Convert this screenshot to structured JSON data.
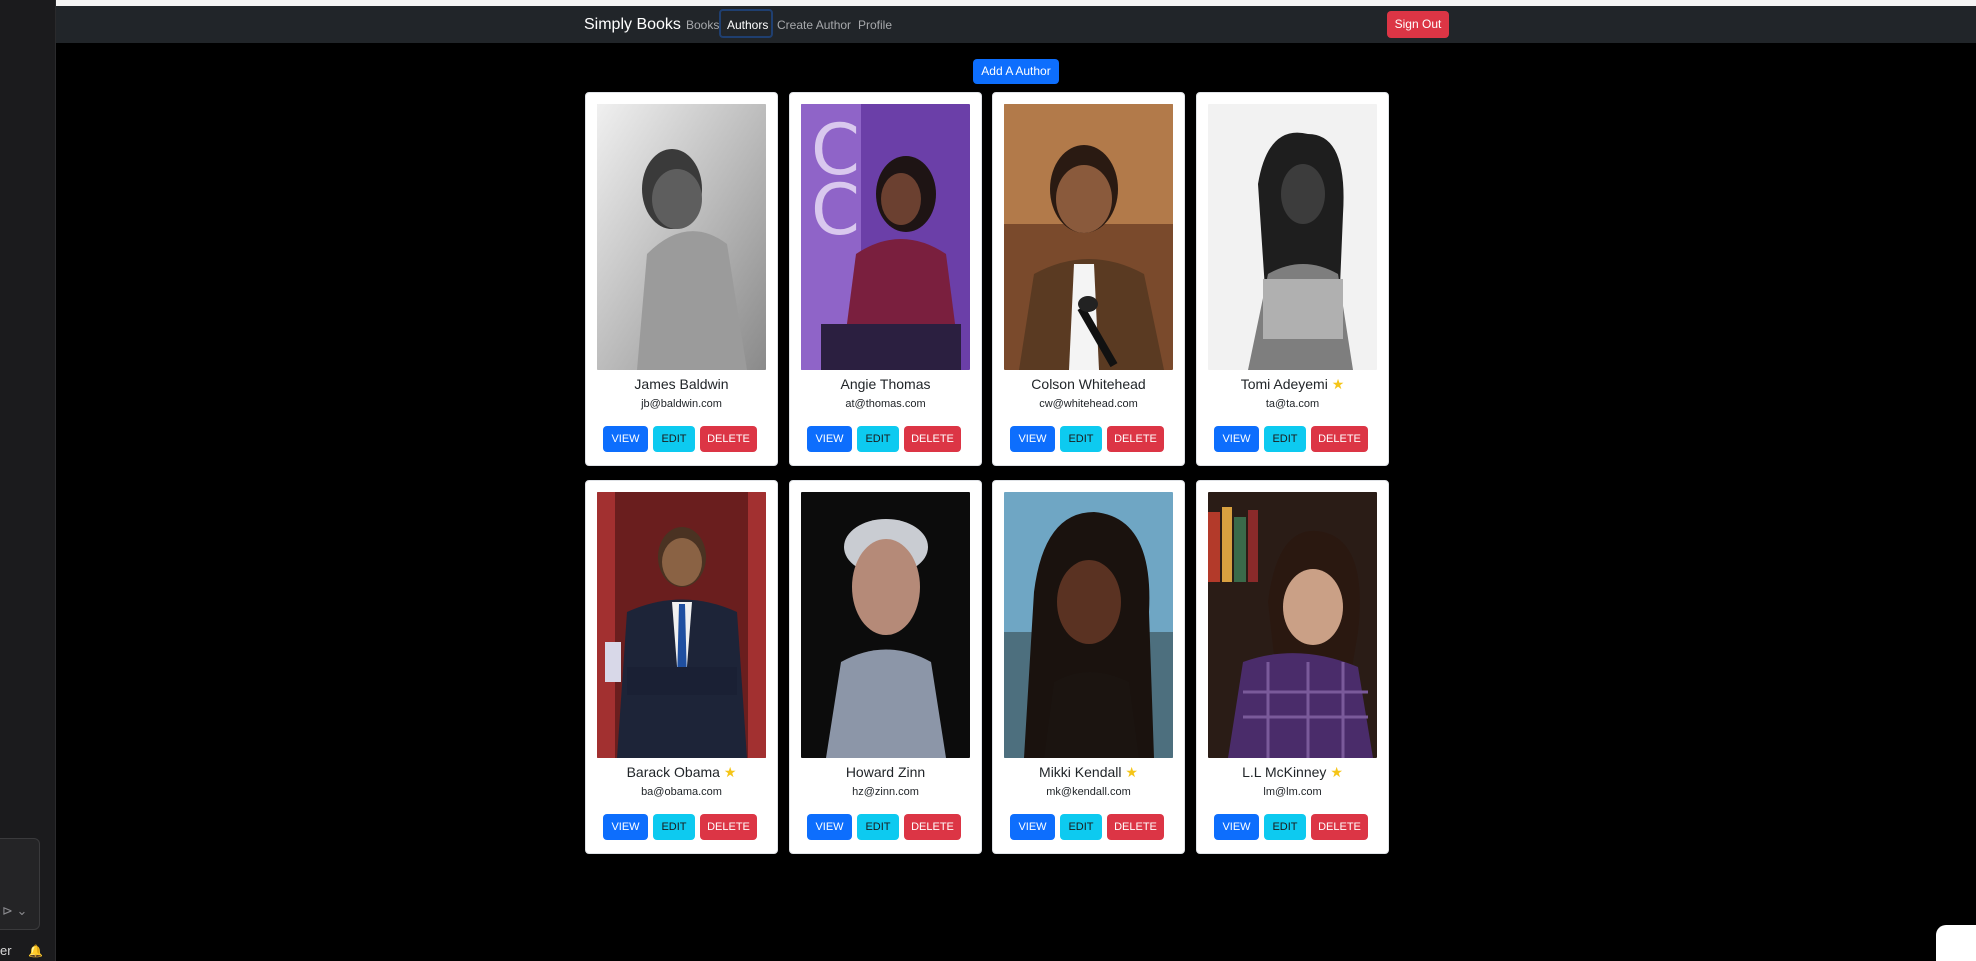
{
  "navbar": {
    "brand": "Simply Books",
    "links": [
      "Books",
      "Authors",
      "Create Author",
      "Profile"
    ],
    "active_link": "Authors",
    "sign_out": "Sign Out"
  },
  "add_author_label": "Add A Author",
  "authors": [
    {
      "name": "James Baldwin",
      "email": "jb@baldwin.com",
      "favorite": false,
      "photo": "bw-man-smiling"
    },
    {
      "name": "Angie Thomas",
      "email": "at@thomas.com",
      "favorite": false,
      "photo": "woman-purple-backdrop"
    },
    {
      "name": "Colson Whitehead",
      "email": "cw@whitehead.com",
      "favorite": false,
      "photo": "man-microphone"
    },
    {
      "name": "Tomi Adeyemi",
      "email": "ta@ta.com",
      "favorite": true,
      "photo": "bw-woman-locs"
    },
    {
      "name": "Barack Obama",
      "email": "ba@obama.com",
      "favorite": true,
      "photo": "man-suit-office"
    },
    {
      "name": "Howard Zinn",
      "email": "hz@zinn.com",
      "favorite": false,
      "photo": "older-man-dark"
    },
    {
      "name": "Mikki Kendall",
      "email": "mk@kendall.com",
      "favorite": true,
      "photo": "woman-locs-blue"
    },
    {
      "name": "L.L McKinney",
      "email": "lm@lm.com",
      "favorite": true,
      "photo": "woman-bookshelf"
    }
  ],
  "card_buttons": {
    "view": "VIEW",
    "edit": "EDIT",
    "delete": "DELETE"
  },
  "favorite_icon": "★",
  "left_panel": {
    "send_icon": "⊳ ⌄",
    "bottom_text": "er",
    "bell_icon": "🔔"
  },
  "colors": {
    "navbar": "#212529",
    "primary": "#0d6efd",
    "info": "#0dcaf0",
    "danger": "#dc3545",
    "background": "#000000"
  }
}
